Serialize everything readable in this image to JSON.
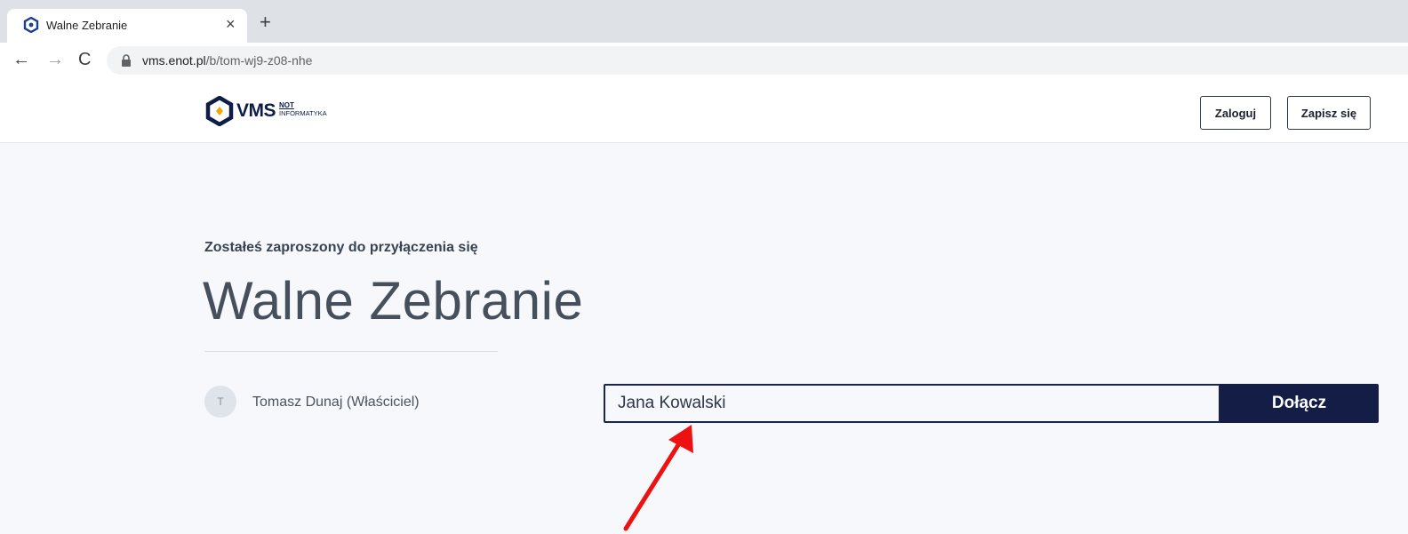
{
  "browser": {
    "tab_title": "Walne Zebranie",
    "tab_close": "×",
    "new_tab": "+",
    "nav_back": "←",
    "nav_forward": "→",
    "nav_reload": "C",
    "url_host": "vms.enot.pl",
    "url_path": "/b/tom-wj9-z08-nhe"
  },
  "header": {
    "logo_brand": "VMS",
    "logo_not": "NOT",
    "logo_sub": "INFORMATYKA",
    "login_label": "Zaloguj",
    "signup_label": "Zapisz się"
  },
  "main": {
    "invite_label": "Zostałeś zaproszony do przyłączenia się",
    "meeting_title": "Walne Zebranie",
    "owner_initial": "T",
    "owner_name": "Tomasz Dunaj (Właściciel)",
    "name_input_value": "Jana Kowalski",
    "join_label": "Dołącz"
  },
  "colors": {
    "brand_navy": "#131d45",
    "annotation_arrow": "#ee1111"
  },
  "icons": [
    "settings-favicon-icon",
    "lock-icon",
    "logo-mark-icon",
    "annotation-arrow"
  ]
}
